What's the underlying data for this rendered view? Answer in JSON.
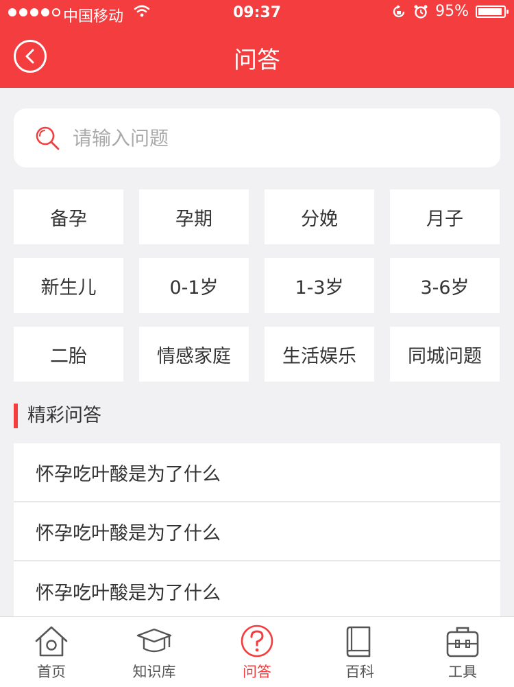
{
  "status_bar": {
    "carrier": "中国移动",
    "time": "09:37",
    "battery_percent": "95%",
    "battery_level": 0.95
  },
  "header": {
    "title": "问答"
  },
  "search": {
    "placeholder": "请输入问题"
  },
  "categories": [
    "备孕",
    "孕期",
    "分娩",
    "月子",
    "新生儿",
    "0-1岁",
    "1-3岁",
    "3-6岁",
    "二胎",
    "情感家庭",
    "生活娱乐",
    "同城问题"
  ],
  "section": {
    "title": "精彩问答"
  },
  "qa_items": [
    "怀孕吃叶酸是为了什么",
    "怀孕吃叶酸是为了什么",
    "怀孕吃叶酸是为了什么"
  ],
  "tabs": [
    {
      "label": "首页",
      "icon": "home-icon"
    },
    {
      "label": "知识库",
      "icon": "graduation-cap-icon"
    },
    {
      "label": "问答",
      "icon": "question-circle-icon",
      "active": true
    },
    {
      "label": "百科",
      "icon": "book-icon"
    },
    {
      "label": "工具",
      "icon": "toolbox-icon"
    }
  ],
  "colors": {
    "accent": "#f33d3e",
    "background": "#f1f0f3",
    "text": "#333333"
  }
}
